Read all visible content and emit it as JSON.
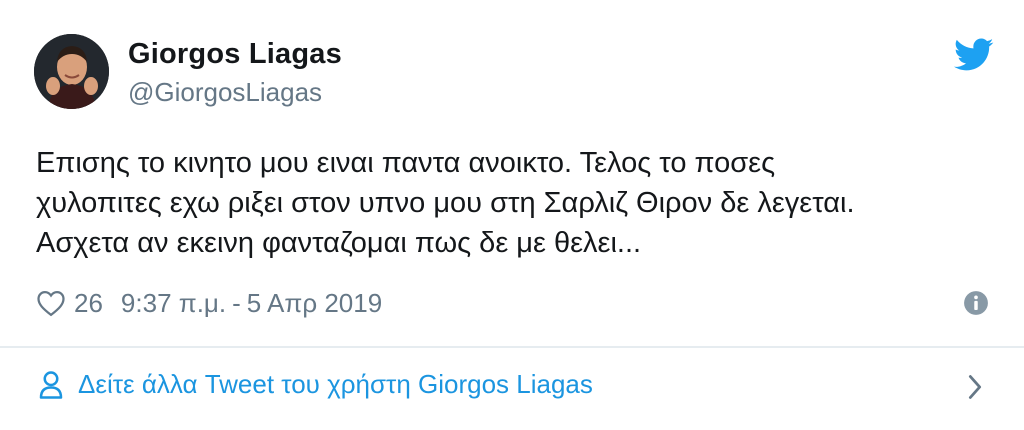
{
  "tweet": {
    "author_name": "Giorgos Liagas",
    "author_handle": "@GiorgosLiagas",
    "text_lines": [
      "Επισης το κινητο μου ειναι παντα ανοικτο. Τελος το ποσες",
      "χυλοπιτες εχω ριξει στον υπνο μου στη Σαρλιζ Θιρον δε λεγεται.",
      "Ασχετα αν εκεινη φανταζομαι πως δε με θελει..."
    ],
    "likes": "26",
    "time": "9:37 π.μ.",
    "separator": "-",
    "date": "5 Απρ 2019"
  },
  "footer": {
    "more_tweets_label": "Δείτε άλλα Tweet του χρήστη Giorgos Liagas"
  },
  "colors": {
    "brand_blue": "#1da1f2",
    "link_blue": "#1b95e0",
    "secondary_text": "#657786",
    "primary_text": "#14171a",
    "divider": "#e6ecf0"
  },
  "icons": [
    "twitter-bird-icon",
    "heart-icon",
    "info-icon",
    "person-icon",
    "chevron-right-icon"
  ]
}
